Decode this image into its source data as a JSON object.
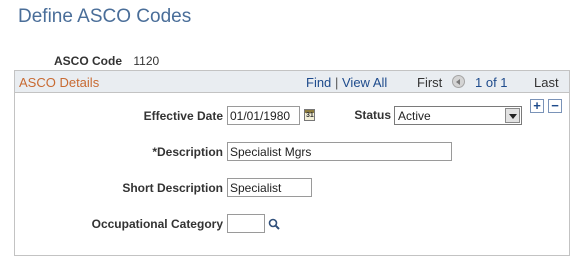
{
  "page": {
    "title": "Define ASCO Codes"
  },
  "key": {
    "label": "ASCO Code",
    "value": "1120"
  },
  "grid": {
    "title": "ASCO Details",
    "find_label": "Find",
    "separator": "|",
    "view_all_label": "View All",
    "first_label": "First",
    "pager": "1 of 1",
    "last_label": "Last"
  },
  "form": {
    "effective_date": {
      "label": "Effective Date",
      "value": "01/01/1980",
      "calendar_icon_text": "31"
    },
    "status": {
      "label": "Status",
      "value": "Active"
    },
    "description": {
      "label": "*Description",
      "value": "Specialist Mgrs"
    },
    "short_description": {
      "label": "Short Description",
      "value": "Specialist"
    },
    "occupational_category": {
      "label": "Occupational Category",
      "value": ""
    }
  },
  "row_buttons": {
    "add": "+",
    "remove": "−"
  },
  "icons": {
    "calendar": "calendar-icon",
    "lookup": "magnifier-icon",
    "prev": "previous-arrow-icon",
    "dropdown": "chevron-down-icon"
  },
  "colors": {
    "title": "#4a6e99",
    "grid_title": "#c86a32",
    "link": "#1e4b8c",
    "grid_header_bg": "#e9edf1"
  }
}
